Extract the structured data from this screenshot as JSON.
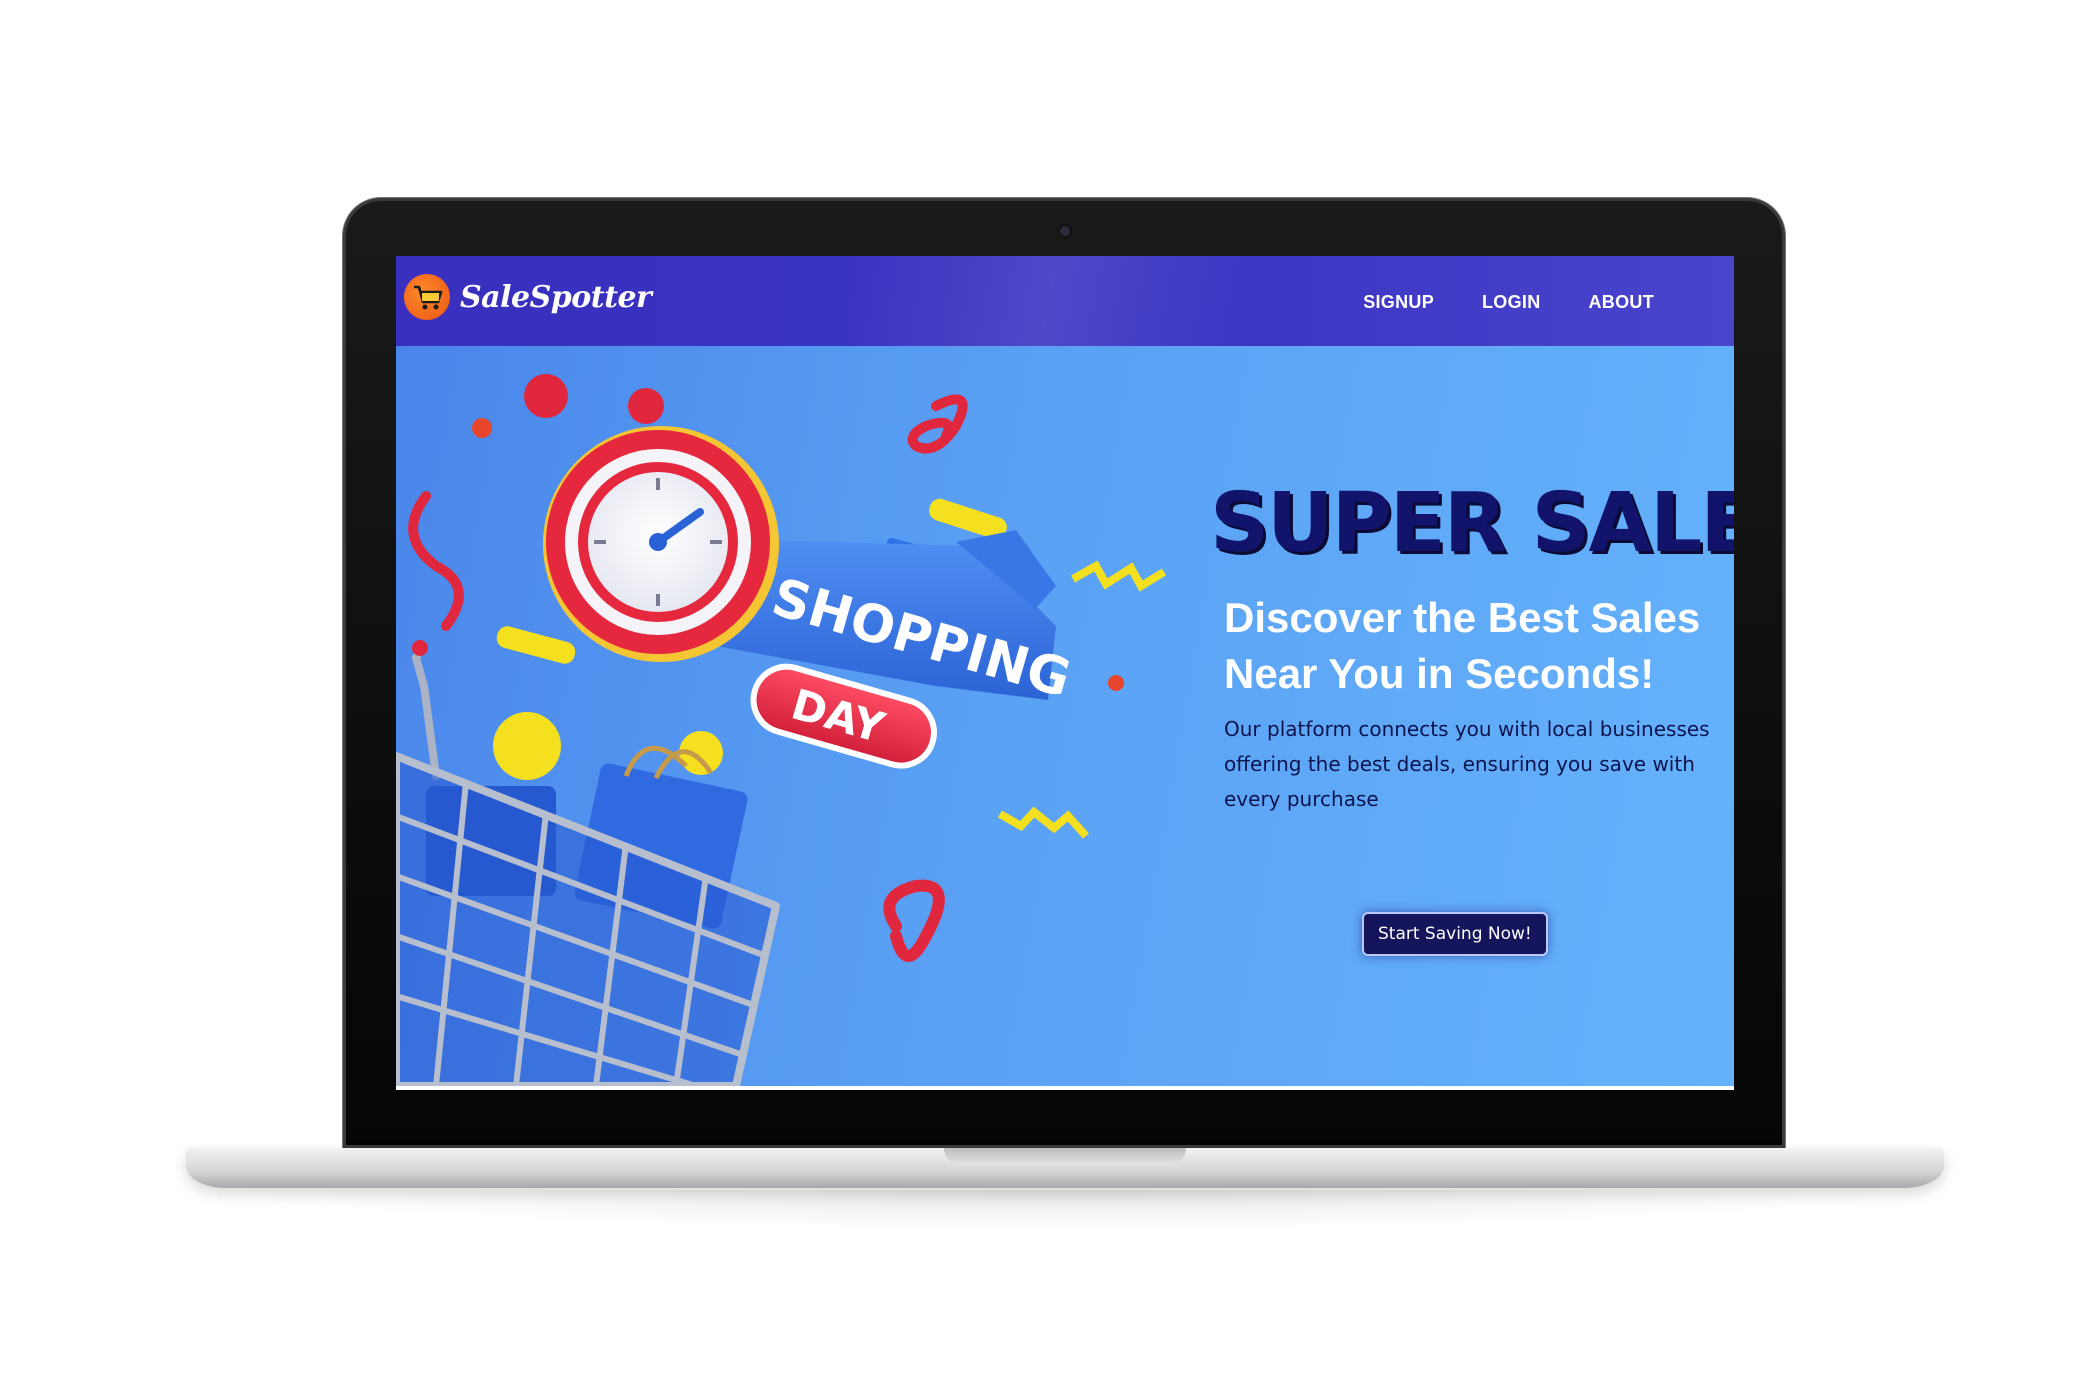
{
  "brand": {
    "name": "SaleSpotter"
  },
  "nav": {
    "links": [
      {
        "label": "SIGNUP"
      },
      {
        "label": "LOGIN"
      },
      {
        "label": "ABOUT"
      }
    ]
  },
  "hero": {
    "title": "SUPER SALE",
    "subtitle_line1": "Discover the Best Sales",
    "subtitle_line2": "Near You in Seconds!",
    "description": "Our platform connects you with local businesses offering the best deals, ensuring you save with every purchase",
    "cta_label": "Start Saving Now!",
    "illustration": {
      "banner_text": "SHOPPING",
      "tag_text": "DAY"
    }
  },
  "colors": {
    "nav_bg": "#3b34c3",
    "hero_bg": "#5aa1f4",
    "title": "#12136a",
    "cta_bg": "#14155a",
    "accent_red": "#e8334a",
    "accent_yellow": "#f5e020"
  },
  "icons": [
    "shopping-cart-logo-icon",
    "alarm-clock-icon",
    "shopping-cart-icon",
    "shopping-bag-icon"
  ]
}
